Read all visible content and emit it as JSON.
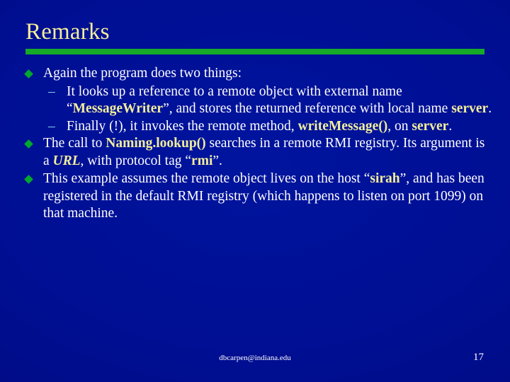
{
  "slide": {
    "title": "Remarks",
    "accent_bar_color": "#16aa28",
    "background_color": "#000f93",
    "title_color": "#f2ee9b",
    "body_color": "#ffffff",
    "highlight_color": "#f2ee9b",
    "bullet_diamond_color": "#00a82d",
    "dash_color": "#7fd4e8"
  },
  "bullets": {
    "b1": {
      "marker": "diamond",
      "text": "Again the program does two things:"
    },
    "b1s1": {
      "marker": "en-dash",
      "t1": "It looks up a reference to a remote object with external name “",
      "code1": "MessageWriter",
      "t2": "”, and stores the returned reference with local name ",
      "code2": "server",
      "t3": "."
    },
    "b1s2": {
      "marker": "en-dash",
      "t1": "Finally (!), it invokes the remote method, ",
      "code1": "writeMessage()",
      "t2": ", on ",
      "code2": "server",
      "t3": "."
    },
    "b2": {
      "marker": "diamond",
      "t1": "The call to ",
      "code1": "Naming.lookup()",
      "t2": " searches in a remote RMI registry.  Its argument is a ",
      "code2": "URL",
      "t3": ", with protocol tag “",
      "code3": "rmi",
      "t4": "”."
    },
    "b3": {
      "marker": "diamond",
      "t1": "This example assumes the remote object lives on the host “",
      "code1": "sirah",
      "t2": "”, and has been registered in the default RMI registry (which happens to listen on port 1099) on that machine."
    }
  },
  "footer": {
    "email": "dbcarpen@indiana.edu",
    "page_number": "17"
  }
}
